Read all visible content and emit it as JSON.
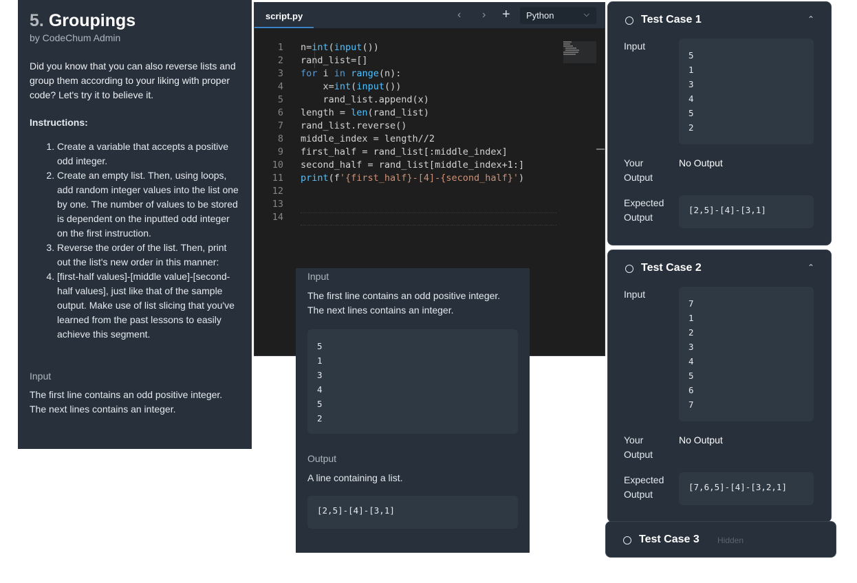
{
  "problem": {
    "number": "5.",
    "name": "Groupings",
    "author": "by CodeChum Admin",
    "description": "Did you know that you can also reverse lists and group them according to your liking with proper code? Let's try it to believe it.",
    "instructions_title": "Instructions:",
    "instructions": [
      "Create a variable that accepts a positive odd integer.",
      "Create an empty list. Then, using loops, add random integer values into the list one by one. The number of values to be stored is dependent on the inputted odd integer on the first instruction.",
      "Reverse the order of the list. Then, print out the list's new order in this manner:",
      "[first-half values]-[middle value]-[second-half values], just like that of the sample output. Make use of list slicing that you've learned from the past lessons to easily achieve this segment."
    ],
    "input_label": "Input",
    "input_text": "The first line contains an odd positive integer. The next lines contains an integer."
  },
  "editor": {
    "tab_label": "script.py",
    "language": "Python",
    "line_numbers": [
      "1",
      "2",
      "3",
      "4",
      "5",
      "6",
      "7",
      "8",
      "9",
      "10",
      "11",
      "12",
      "13",
      "14"
    ]
  },
  "io": {
    "input_label": "Input",
    "input_text": "The first line contains an odd positive integer. The next lines contains an integer.",
    "sample_input": [
      "5",
      "1",
      "3",
      "4",
      "5",
      "2"
    ],
    "output_label": "Output",
    "output_text": "A line containing a list.",
    "sample_output": "[2,5]-[4]-[3,1]"
  },
  "test_cases": [
    {
      "title": "Test Case 1",
      "input_label": "Input",
      "input": [
        "5",
        "1",
        "3",
        "4",
        "5",
        "2"
      ],
      "your_output_label": "Your Output",
      "your_output": "No Output",
      "expected_label": "Expected Output",
      "expected": "[2,5]-[4]-[3,1]"
    },
    {
      "title": "Test Case 2",
      "input_label": "Input",
      "input": [
        "7",
        "1",
        "2",
        "3",
        "4",
        "5",
        "6",
        "7"
      ],
      "your_output_label": "Your Output",
      "your_output": "No Output",
      "expected_label": "Expected Output",
      "expected": "[7,6,5]-[4]-[3,2,1]"
    },
    {
      "title": "Test Case 3",
      "status": "Hidden"
    }
  ],
  "icons": {
    "prev": "chevron-left-icon",
    "next": "chevron-right-icon",
    "add": "plus-icon",
    "dropdown": "chevron-down-icon",
    "collapse": "chevron-up-icon",
    "status": "circle-icon"
  },
  "colors": {
    "panel_bg": "#27303b",
    "editor_bg": "#1e1e1e",
    "keyword": "#569cd6",
    "builtin": "#4fc1ff",
    "string": "#ce9178",
    "tab_underline": "#3b82c4"
  }
}
